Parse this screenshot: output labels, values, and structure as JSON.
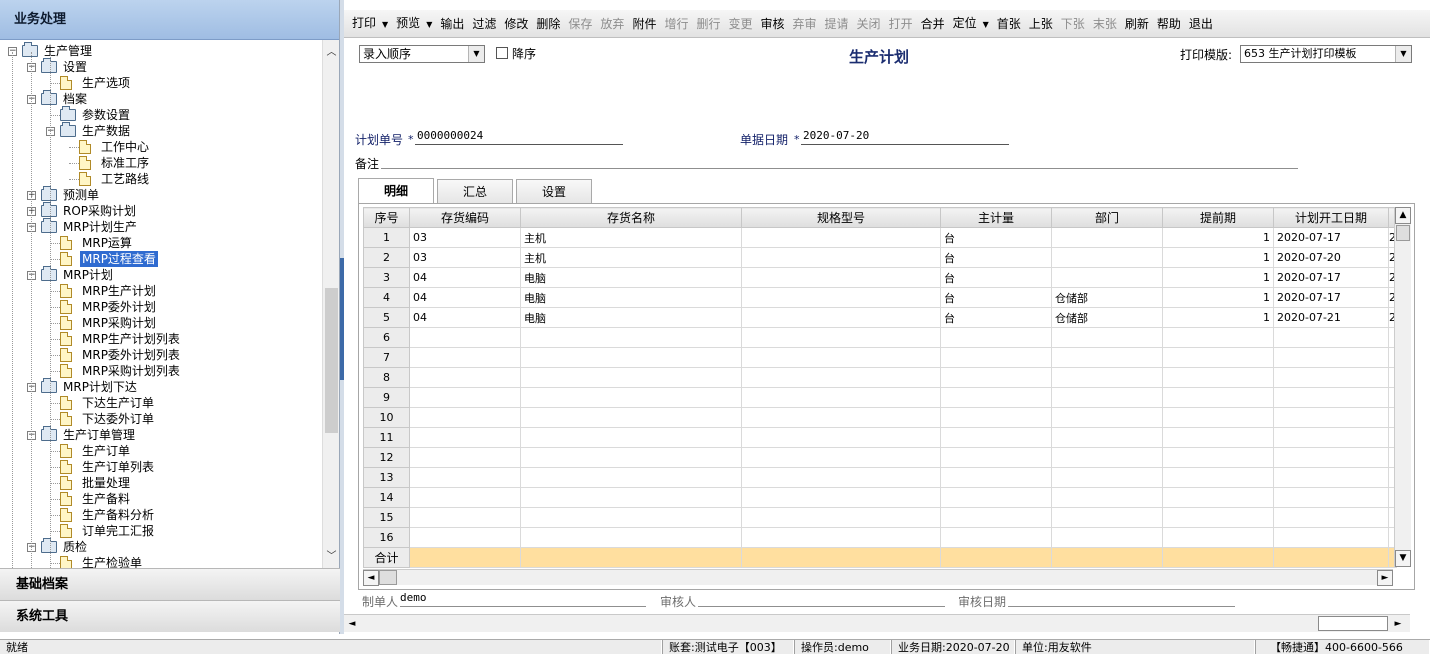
{
  "left_panel": {
    "header": "业务处理",
    "tree": [
      {
        "level": 0,
        "label": "生产管理",
        "icon": "folder-open-icon",
        "toggle": "minus"
      },
      {
        "level": 1,
        "label": "设置",
        "icon": "folder-open-icon",
        "toggle": "minus"
      },
      {
        "level": 2,
        "label": "生产选项",
        "icon": "document-icon"
      },
      {
        "level": 1,
        "label": "档案",
        "icon": "folder-open-icon",
        "toggle": "minus"
      },
      {
        "level": 2,
        "label": "参数设置",
        "icon": "folder-icon"
      },
      {
        "level": 2,
        "label": "生产数据",
        "icon": "folder-open-icon",
        "toggle": "minus"
      },
      {
        "level": 3,
        "label": "工作中心",
        "icon": "document-icon"
      },
      {
        "level": 3,
        "label": "标准工序",
        "icon": "document-icon"
      },
      {
        "level": 3,
        "label": "工艺路线",
        "icon": "document-icon"
      },
      {
        "level": 1,
        "label": "预测单",
        "icon": "folder-icon",
        "toggle": "plus"
      },
      {
        "level": 1,
        "label": "ROP采购计划",
        "icon": "folder-icon",
        "toggle": "plus"
      },
      {
        "level": 1,
        "label": "MRP计划生产",
        "icon": "folder-open-icon",
        "toggle": "minus"
      },
      {
        "level": 2,
        "label": "MRP运算",
        "icon": "document-icon"
      },
      {
        "level": 2,
        "label": "MRP过程查看",
        "icon": "document-icon",
        "selected": true
      },
      {
        "level": 1,
        "label": "MRP计划",
        "icon": "folder-open-icon",
        "toggle": "minus"
      },
      {
        "level": 2,
        "label": "MRP生产计划",
        "icon": "document-icon"
      },
      {
        "level": 2,
        "label": "MRP委外计划",
        "icon": "document-icon"
      },
      {
        "level": 2,
        "label": "MRP采购计划",
        "icon": "document-icon"
      },
      {
        "level": 2,
        "label": "MRP生产计划列表",
        "icon": "document-icon"
      },
      {
        "level": 2,
        "label": "MRP委外计划列表",
        "icon": "document-icon"
      },
      {
        "level": 2,
        "label": "MRP采购计划列表",
        "icon": "document-icon"
      },
      {
        "level": 1,
        "label": "MRP计划下达",
        "icon": "folder-open-icon",
        "toggle": "minus"
      },
      {
        "level": 2,
        "label": "下达生产订单",
        "icon": "document-icon"
      },
      {
        "level": 2,
        "label": "下达委外订单",
        "icon": "document-icon"
      },
      {
        "level": 1,
        "label": "生产订单管理",
        "icon": "folder-open-icon",
        "toggle": "minus"
      },
      {
        "level": 2,
        "label": "生产订单",
        "icon": "document-icon"
      },
      {
        "level": 2,
        "label": "生产订单列表",
        "icon": "document-icon"
      },
      {
        "level": 2,
        "label": "批量处理",
        "icon": "document-icon"
      },
      {
        "level": 2,
        "label": "生产备料",
        "icon": "document-icon"
      },
      {
        "level": 2,
        "label": "生产备料分析",
        "icon": "document-icon"
      },
      {
        "level": 2,
        "label": "订单完工汇报",
        "icon": "document-icon"
      },
      {
        "level": 1,
        "label": "质检",
        "icon": "folder-open-icon",
        "toggle": "minus"
      },
      {
        "level": 2,
        "label": "生产检验单",
        "icon": "document-icon"
      }
    ],
    "nav_basic": "基础档案",
    "nav_tools": "系统工具"
  },
  "toolbar": [
    {
      "label": "打印",
      "dropdown": true,
      "enabled": true
    },
    {
      "label": "预览",
      "dropdown": true,
      "enabled": true
    },
    {
      "label": "输出",
      "enabled": true
    },
    {
      "label": "过滤",
      "enabled": true
    },
    {
      "label": "修改",
      "enabled": true
    },
    {
      "label": "删除",
      "enabled": true
    },
    {
      "label": "保存",
      "enabled": false
    },
    {
      "label": "放弃",
      "enabled": false
    },
    {
      "label": "附件",
      "enabled": true
    },
    {
      "label": "增行",
      "enabled": false
    },
    {
      "label": "删行",
      "enabled": false
    },
    {
      "label": "变更",
      "enabled": false
    },
    {
      "label": "审核",
      "enabled": true
    },
    {
      "label": "弃审",
      "enabled": false
    },
    {
      "label": "提请",
      "enabled": false
    },
    {
      "label": "关闭",
      "enabled": false
    },
    {
      "label": "打开",
      "enabled": false
    },
    {
      "label": "合并",
      "enabled": true
    },
    {
      "label": "定位",
      "dropdown": true,
      "enabled": true
    },
    {
      "label": "首张",
      "enabled": true
    },
    {
      "label": "上张",
      "enabled": true
    },
    {
      "label": "下张",
      "enabled": false
    },
    {
      "label": "末张",
      "enabled": false
    },
    {
      "label": "刷新",
      "enabled": true
    },
    {
      "label": "帮助",
      "enabled": true
    },
    {
      "label": "退出",
      "enabled": true
    }
  ],
  "form": {
    "sort_select": "录入顺序",
    "desc_label": "降序",
    "title": "生产计划",
    "print_template_label": "打印模版:",
    "print_template_value": "653 生产计划打印模板",
    "plan_no_label": "计划单号",
    "plan_no_value": "0000000024",
    "doc_date_label": "单据日期",
    "doc_date_value": "2020-07-20",
    "required_mark": "*",
    "remark_label": "备注"
  },
  "tabs": [
    "明细",
    "汇总",
    "设置"
  ],
  "grid": {
    "columns": [
      "序号",
      "存货编码",
      "存货名称",
      "规格型号",
      "主计量",
      "部门",
      "提前期",
      "计划开工日期"
    ],
    "rows": [
      [
        "1",
        "03",
        "主机",
        "",
        "台",
        "",
        "1",
        "2020-07-17"
      ],
      [
        "2",
        "03",
        "主机",
        "",
        "台",
        "",
        "1",
        "2020-07-20"
      ],
      [
        "3",
        "04",
        "电脑",
        "",
        "台",
        "",
        "1",
        "2020-07-17"
      ],
      [
        "4",
        "04",
        "电脑",
        "",
        "台",
        "仓储部",
        "1",
        "2020-07-17"
      ],
      [
        "5",
        "04",
        "电脑",
        "",
        "台",
        "仓储部",
        "1",
        "2020-07-21"
      ],
      [
        "6",
        "",
        "",
        "",
        "",
        "",
        "",
        ""
      ],
      [
        "7",
        "",
        "",
        "",
        "",
        "",
        "",
        ""
      ],
      [
        "8",
        "",
        "",
        "",
        "",
        "",
        "",
        ""
      ],
      [
        "9",
        "",
        "",
        "",
        "",
        "",
        "",
        ""
      ],
      [
        "10",
        "",
        "",
        "",
        "",
        "",
        "",
        ""
      ],
      [
        "11",
        "",
        "",
        "",
        "",
        "",
        "",
        ""
      ],
      [
        "12",
        "",
        "",
        "",
        "",
        "",
        "",
        ""
      ],
      [
        "13",
        "",
        "",
        "",
        "",
        "",
        "",
        ""
      ],
      [
        "14",
        "",
        "",
        "",
        "",
        "",
        "",
        ""
      ],
      [
        "15",
        "",
        "",
        "",
        "",
        "",
        "",
        ""
      ],
      [
        "16",
        "",
        "",
        "",
        "",
        "",
        "",
        ""
      ]
    ],
    "total_label": "合计"
  },
  "footer": {
    "maker_label": "制单人",
    "maker_value": "demo",
    "auditor_label": "审核人",
    "audit_date_label": "审核日期"
  },
  "status_bar": {
    "ready": "就绪",
    "account": "账套:测试电子【003】",
    "operator": "操作员:demo",
    "business_date": "业务日期:2020-07-20",
    "unit": "单位:用友软件",
    "hotline": "【畅捷通】400-6600-566"
  },
  "colors": {
    "header_blue": "#9fbde3",
    "title_navy": "#1b2d70",
    "total_row": "#ffdf9f",
    "selection": "#2f6bd0"
  }
}
